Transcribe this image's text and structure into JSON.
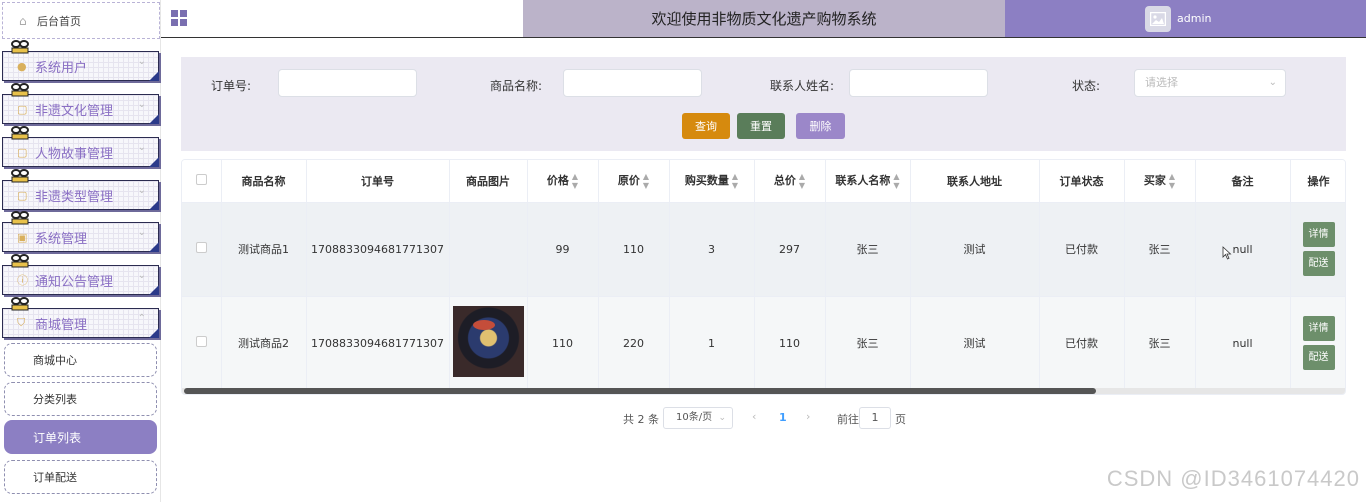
{
  "sidebar": {
    "home": "后台首页",
    "menus": [
      {
        "label": "系统用户",
        "icon": "user-icon",
        "chev": "⌄"
      },
      {
        "label": "非遗文化管理",
        "icon": "book-icon",
        "chev": "⌄"
      },
      {
        "label": "人物故事管理",
        "icon": "book-icon",
        "chev": "⌄"
      },
      {
        "label": "非遗类型管理",
        "icon": "book-icon",
        "chev": "⌄"
      },
      {
        "label": "系统管理",
        "icon": "image-icon",
        "chev": "⌄"
      },
      {
        "label": "通知公告管理",
        "icon": "info-icon",
        "chev": "⌄"
      },
      {
        "label": "商城管理",
        "icon": "cart-icon",
        "chev": "⌃"
      }
    ],
    "sub_items": [
      "商城中心",
      "分类列表",
      "订单列表",
      "订单配送"
    ],
    "active_sub": "订单列表"
  },
  "header": {
    "title": "欢迎使用非物质文化遗产购物系统",
    "username": "admin"
  },
  "search": {
    "order_no_label": "订单号:",
    "product_name_label": "商品名称:",
    "contact_name_label": "联系人姓名:",
    "status_label": "状态:",
    "status_placeholder": "请选择",
    "query_btn": "查询",
    "reset_btn": "重置",
    "delete_btn": "删除"
  },
  "table": {
    "headers": [
      "商品名称",
      "订单号",
      "商品图片",
      "价格",
      "原价",
      "购买数量",
      "总价",
      "联系人名称",
      "联系人地址",
      "订单状态",
      "买家",
      "备注",
      "操作"
    ],
    "rows": [
      {
        "name": "测试商品1",
        "order_no": "1708833094681771307",
        "image": "",
        "price": "99",
        "orig_price": "110",
        "qty": "3",
        "total": "297",
        "contact": "张三",
        "address": "测试",
        "status": "已付款",
        "buyer": "张三",
        "remark": "null"
      },
      {
        "name": "测试商品2",
        "order_no": "1708833094681771307",
        "image": "product-image",
        "price": "110",
        "orig_price": "220",
        "qty": "1",
        "total": "110",
        "contact": "张三",
        "address": "测试",
        "status": "已付款",
        "buyer": "张三",
        "remark": "null"
      }
    ],
    "detail_btn": "详情",
    "ship_btn": "配送"
  },
  "pagination": {
    "total": "共 2 条",
    "page_size": "10条/页",
    "current_page": "1",
    "goto_label": "前往",
    "goto_value": "1",
    "page_suffix": "页"
  },
  "watermark": "CSDN @ID3461074420",
  "colors": {
    "accent": "#8c7fc3",
    "query": "#d68a0e",
    "reset": "#5a7d5a",
    "delete": "#9b87c9",
    "op": "#6d8f6b"
  }
}
